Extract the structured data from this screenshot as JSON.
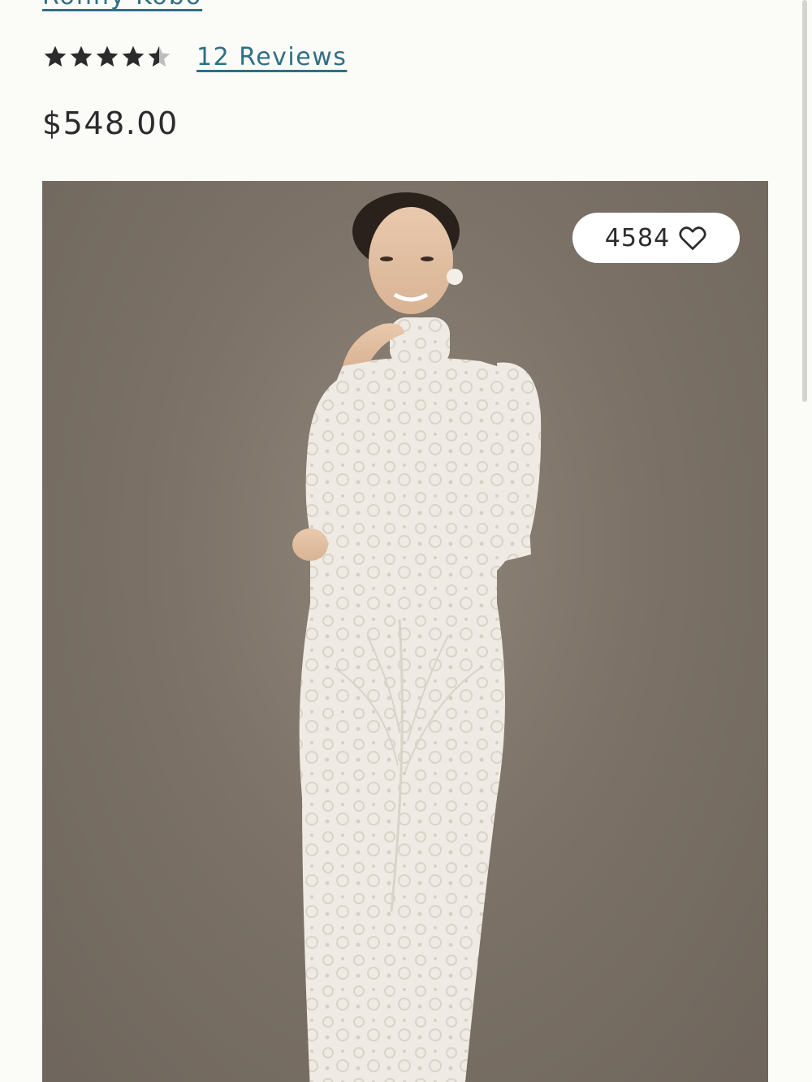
{
  "product": {
    "brand": "Ronny Kobo",
    "rating_value": 4.5,
    "rating_max": 5,
    "reviews_label": "12 Reviews",
    "price": "$548.00",
    "like_count": "4584"
  },
  "image": {
    "description_icon": "product-photo"
  },
  "colors": {
    "link": "#2f6f83",
    "text": "#2b2b2b",
    "background": "#fbfbf8",
    "image_backdrop": "#7c7267"
  }
}
